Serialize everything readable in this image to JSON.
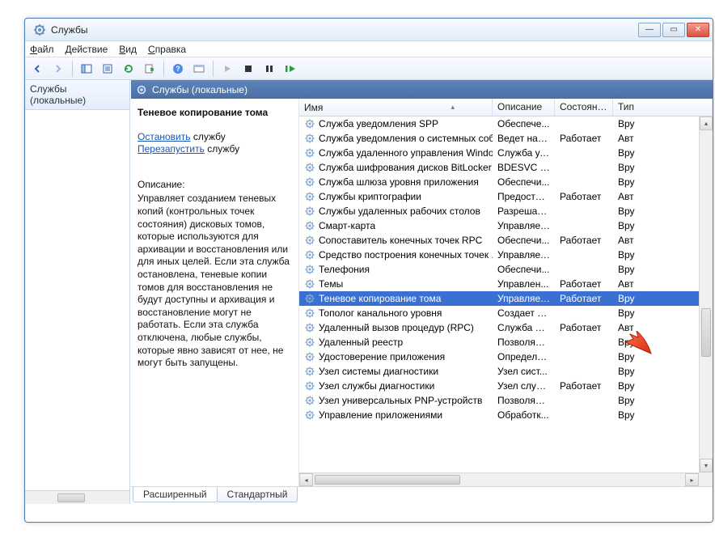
{
  "window": {
    "title": "Службы"
  },
  "menu": {
    "file": "Файл",
    "action": "Действие",
    "view": "Вид",
    "help": "Справка"
  },
  "left": {
    "node": "Службы (локальные)"
  },
  "right_header": "Службы (локальные)",
  "detail": {
    "name": "Теневое копирование тома",
    "stop_link": "Остановить",
    "stop_suffix": " службу",
    "restart_link": "Перезапустить",
    "restart_suffix": " службу",
    "desc_label": "Описание:",
    "desc_text": "Управляет созданием теневых копий (контрольных точек состояния) дисковых томов, которые используются для архивации и восстановления или для иных целей. Если эта служба остановлена, теневые копии томов для восстановления не будут доступны и архивация и восстановление могут не работать. Если эта служба отключена, любые службы, которые явно зависят от нее, не могут быть запущены."
  },
  "columns": {
    "name": "Имя",
    "desc": "Описание",
    "state": "Состояние",
    "type": "Тип"
  },
  "rows": [
    {
      "name": "Служба уведомления SPP",
      "desc": "Обеспече...",
      "state": "",
      "type": "Вру"
    },
    {
      "name": "Служба уведомления о системных соб...",
      "desc": "Ведет наб...",
      "state": "Работает",
      "type": "Авт"
    },
    {
      "name": "Служба удаленного управления Windo...",
      "desc": "Служба уд...",
      "state": "",
      "type": "Вру"
    },
    {
      "name": "Служба шифрования дисков BitLocker",
      "desc": "BDESVC пр...",
      "state": "",
      "type": "Вру"
    },
    {
      "name": "Служба шлюза уровня приложения",
      "desc": "Обеспечи...",
      "state": "",
      "type": "Вру"
    },
    {
      "name": "Службы криптографии",
      "desc": "Предостав...",
      "state": "Работает",
      "type": "Авт"
    },
    {
      "name": "Службы удаленных рабочих столов",
      "desc": "Разрешает...",
      "state": "",
      "type": "Вру"
    },
    {
      "name": "Смарт-карта",
      "desc": "Управляет...",
      "state": "",
      "type": "Вру"
    },
    {
      "name": "Сопоставитель конечных точек RPC",
      "desc": "Обеспечи...",
      "state": "Работает",
      "type": "Авт"
    },
    {
      "name": "Средство построения конечных точек ...",
      "desc": "Управляет...",
      "state": "",
      "type": "Вру"
    },
    {
      "name": "Телефония",
      "desc": "Обеспечи...",
      "state": "",
      "type": "Вру"
    },
    {
      "name": "Темы",
      "desc": "Управлен...",
      "state": "Работает",
      "type": "Авт"
    },
    {
      "name": "Теневое копирование тома",
      "desc": "Управляет...",
      "state": "Работает",
      "type": "Вру",
      "selected": true
    },
    {
      "name": "Тополог канального уровня",
      "desc": "Создает ка...",
      "state": "",
      "type": "Вру"
    },
    {
      "name": "Удаленный вызов процедур (RPC)",
      "desc": "Служба R...",
      "state": "Работает",
      "type": "Авт"
    },
    {
      "name": "Удаленный реестр",
      "desc": "Позволяет...",
      "state": "",
      "type": "Вру"
    },
    {
      "name": "Удостоверение приложения",
      "desc": "Определя...",
      "state": "",
      "type": "Вру"
    },
    {
      "name": "Узел системы диагностики",
      "desc": "Узел сист...",
      "state": "",
      "type": "Вру"
    },
    {
      "name": "Узел службы диагностики",
      "desc": "Узел служ...",
      "state": "Работает",
      "type": "Вру"
    },
    {
      "name": "Узел универсальных PNP-устройств",
      "desc": "Позволяет...",
      "state": "",
      "type": "Вру"
    },
    {
      "name": "Управление приложениями",
      "desc": "Обработк...",
      "state": "",
      "type": "Вру"
    }
  ],
  "tabs": {
    "extended": "Расширенный",
    "standard": "Стандартный"
  }
}
